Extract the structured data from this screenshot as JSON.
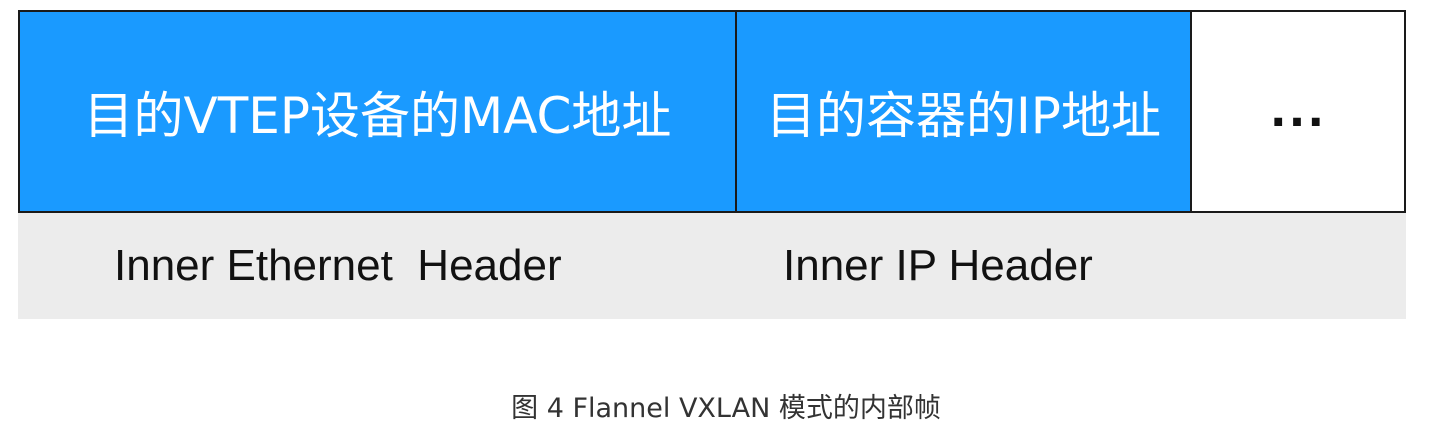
{
  "frame": {
    "cells": [
      {
        "label": "目的VTEP设备的MAC地址"
      },
      {
        "label": "目的容器的IP地址"
      },
      {
        "label": "..."
      }
    ],
    "headers": [
      {
        "label": "Inner Ethernet  Header"
      },
      {
        "label": "Inner IP Header"
      }
    ]
  },
  "caption": "图 4 Flannel VXLAN 模式的内部帧",
  "colors": {
    "cell_fill": "#1a9aff",
    "header_band": "#ececec",
    "border": "#1a1a1a"
  }
}
